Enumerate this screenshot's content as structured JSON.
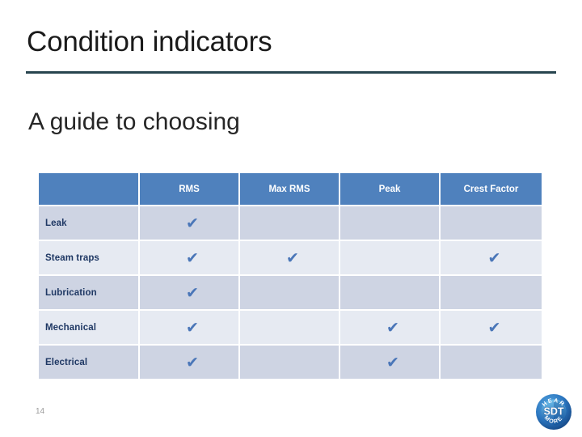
{
  "slide": {
    "title": "Condition indicators",
    "subtitle": "A guide to choosing",
    "page_number": "14",
    "background_color": "#ffffff",
    "rule_color": "#28454f"
  },
  "table": {
    "header_bg": "#4F81BD",
    "header_text_color": "#ffffff",
    "band_dark": "#CED4E3",
    "band_light": "#E6EAF2",
    "check_color": "#4A76B8",
    "label_color": "#1F3864",
    "check_glyph": "✔",
    "columns": [
      {
        "key": "label",
        "label": ""
      },
      {
        "key": "rms",
        "label": "RMS"
      },
      {
        "key": "max_rms",
        "label": "Max RMS"
      },
      {
        "key": "peak",
        "label": "Peak"
      },
      {
        "key": "crest_factor",
        "label": "Crest Factor"
      }
    ],
    "rows": [
      {
        "label": "Leak",
        "rms": true,
        "max_rms": false,
        "peak": false,
        "crest_factor": false
      },
      {
        "label": "Steam traps",
        "rms": true,
        "max_rms": true,
        "peak": false,
        "crest_factor": true
      },
      {
        "label": "Lubrication",
        "rms": true,
        "max_rms": false,
        "peak": false,
        "crest_factor": false
      },
      {
        "label": "Mechanical",
        "rms": true,
        "max_rms": false,
        "peak": true,
        "crest_factor": true
      },
      {
        "label": "Electrical",
        "rms": true,
        "max_rms": false,
        "peak": true,
        "crest_factor": false
      }
    ]
  },
  "logo": {
    "name": "sdt-logo",
    "brand": "SDT",
    "tagline_top": "HEAR",
    "tagline_bottom": "MORE",
    "color_outer": "#1F5FA9",
    "color_inner": "#2E7FC4"
  }
}
